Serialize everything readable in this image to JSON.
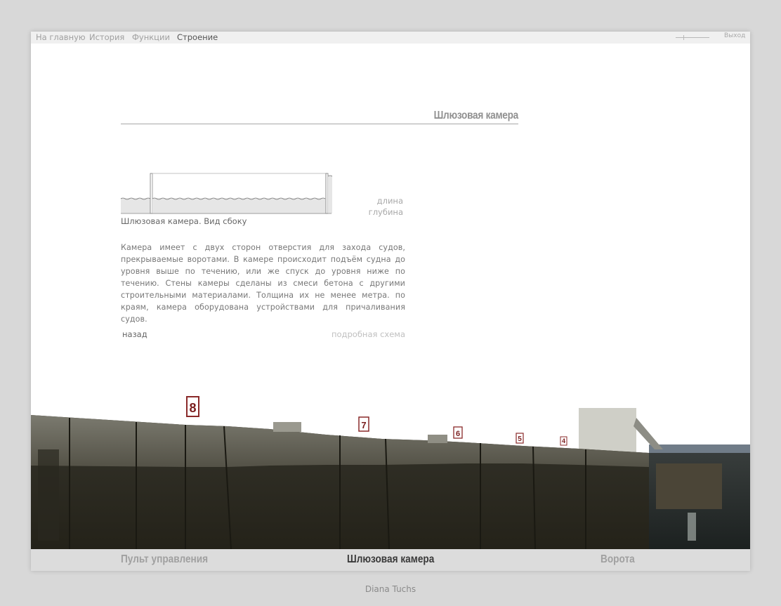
{
  "topnav": {
    "items": [
      "На главную",
      "История",
      "Функции",
      "Строение"
    ],
    "exit_label": "Выход"
  },
  "section": {
    "title": "Шлюзовая камера"
  },
  "diagram": {
    "caption": "Шлюзовая камера. Вид сбоку",
    "legend_length": "длина",
    "legend_depth": "глубина"
  },
  "description": "Камера имеет с двух сторон отверстия для захода судов, прекрывае­мые воротами. В камере происходит подъём судна до уровня выше по течению, или же спуск до уровня ниже по течению. Стены камеры сделаны из смеси бетона с другими строительными материалами. Толщина их не менее метра. по краям, камера оборудована устройст­вами для причаливания судов.",
  "links": {
    "back": "назад",
    "scheme": "подробная схема"
  },
  "photo": {
    "sign_numbers": [
      "8",
      "7",
      "6",
      "5",
      "4"
    ]
  },
  "bottomnav": {
    "left": "Пульт управления",
    "center": "Шлюзовая камера",
    "right": "Ворота"
  },
  "author": "Diana Tuchs"
}
